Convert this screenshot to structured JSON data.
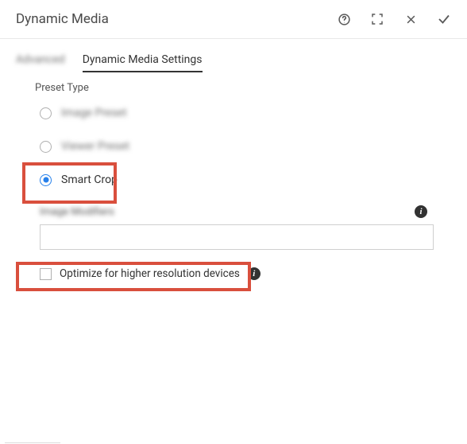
{
  "header": {
    "title": "Dynamic Media"
  },
  "tabs": {
    "advanced": "Advanced",
    "dmSettings": "Dynamic Media Settings"
  },
  "presetType": {
    "label": "Preset Type",
    "options": {
      "imagePreset": "Image Preset",
      "viewerPreset": "Viewer Preset",
      "smartCrop": "Smart Crop"
    }
  },
  "imageModifiers": {
    "label": "Image Modifiers",
    "value": ""
  },
  "optimize": {
    "label": "Optimize for higher resolution devices"
  }
}
